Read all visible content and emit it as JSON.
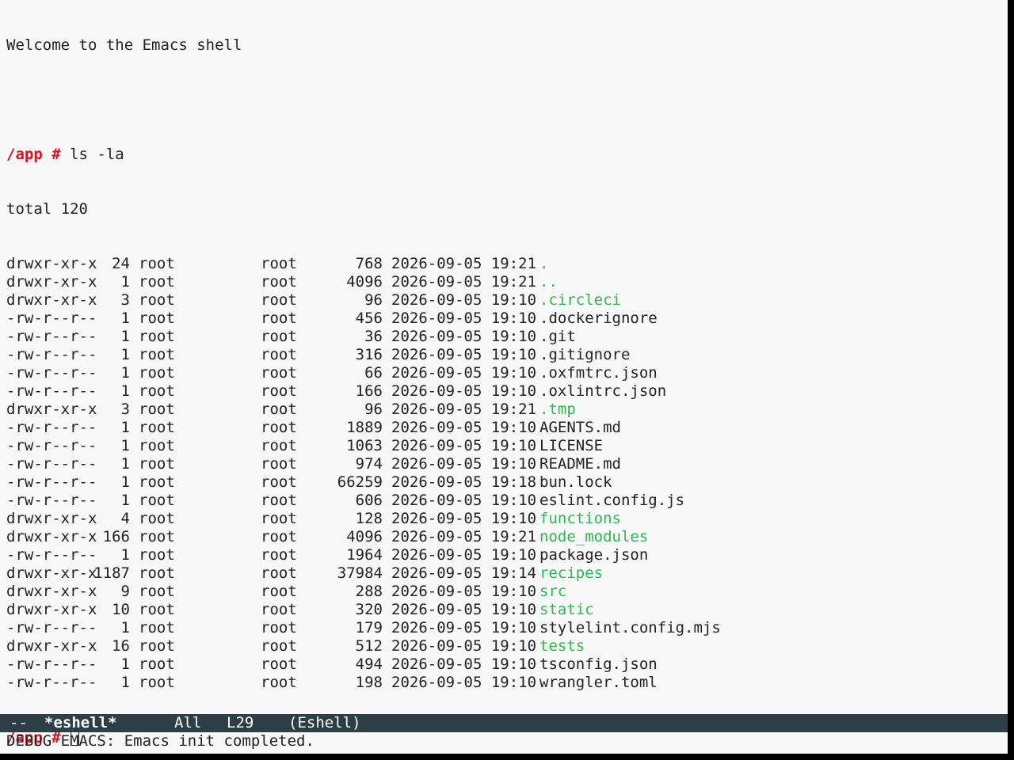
{
  "shell": {
    "welcome": "Welcome to the Emacs shell",
    "prompt": "/app #",
    "command": "ls -la",
    "total": "total 120",
    "prompt_trailing_space": " "
  },
  "listing": [
    {
      "perm": "drwxr-xr-x",
      "links": "24",
      "owner": "root",
      "group": "root",
      "size": "768",
      "date": "2026-09-05 19:21",
      "name": ".",
      "is_dir": true
    },
    {
      "perm": "drwxr-xr-x",
      "links": "1",
      "owner": "root",
      "group": "root",
      "size": "4096",
      "date": "2026-09-05 19:21",
      "name": "..",
      "is_dir": true
    },
    {
      "perm": "drwxr-xr-x",
      "links": "3",
      "owner": "root",
      "group": "root",
      "size": "96",
      "date": "2026-09-05 19:10",
      "name": ".circleci",
      "is_dir": true
    },
    {
      "perm": "-rw-r--r--",
      "links": "1",
      "owner": "root",
      "group": "root",
      "size": "456",
      "date": "2026-09-05 19:10",
      "name": ".dockerignore",
      "is_dir": false
    },
    {
      "perm": "-rw-r--r--",
      "links": "1",
      "owner": "root",
      "group": "root",
      "size": "36",
      "date": "2026-09-05 19:10",
      "name": ".git",
      "is_dir": false
    },
    {
      "perm": "-rw-r--r--",
      "links": "1",
      "owner": "root",
      "group": "root",
      "size": "316",
      "date": "2026-09-05 19:10",
      "name": ".gitignore",
      "is_dir": false
    },
    {
      "perm": "-rw-r--r--",
      "links": "1",
      "owner": "root",
      "group": "root",
      "size": "66",
      "date": "2026-09-05 19:10",
      "name": ".oxfmtrc.json",
      "is_dir": false
    },
    {
      "perm": "-rw-r--r--",
      "links": "1",
      "owner": "root",
      "group": "root",
      "size": "166",
      "date": "2026-09-05 19:10",
      "name": ".oxlintrc.json",
      "is_dir": false
    },
    {
      "perm": "drwxr-xr-x",
      "links": "3",
      "owner": "root",
      "group": "root",
      "size": "96",
      "date": "2026-09-05 19:21",
      "name": ".tmp",
      "is_dir": true
    },
    {
      "perm": "-rw-r--r--",
      "links": "1",
      "owner": "root",
      "group": "root",
      "size": "1889",
      "date": "2026-09-05 19:10",
      "name": "AGENTS.md",
      "is_dir": false
    },
    {
      "perm": "-rw-r--r--",
      "links": "1",
      "owner": "root",
      "group": "root",
      "size": "1063",
      "date": "2026-09-05 19:10",
      "name": "LICENSE",
      "is_dir": false
    },
    {
      "perm": "-rw-r--r--",
      "links": "1",
      "owner": "root",
      "group": "root",
      "size": "974",
      "date": "2026-09-05 19:10",
      "name": "README.md",
      "is_dir": false
    },
    {
      "perm": "-rw-r--r--",
      "links": "1",
      "owner": "root",
      "group": "root",
      "size": "66259",
      "date": "2026-09-05 19:18",
      "name": "bun.lock",
      "is_dir": false
    },
    {
      "perm": "-rw-r--r--",
      "links": "1",
      "owner": "root",
      "group": "root",
      "size": "606",
      "date": "2026-09-05 19:10",
      "name": "eslint.config.js",
      "is_dir": false
    },
    {
      "perm": "drwxr-xr-x",
      "links": "4",
      "owner": "root",
      "group": "root",
      "size": "128",
      "date": "2026-09-05 19:10",
      "name": "functions",
      "is_dir": true
    },
    {
      "perm": "drwxr-xr-x",
      "links": "166",
      "owner": "root",
      "group": "root",
      "size": "4096",
      "date": "2026-09-05 19:21",
      "name": "node_modules",
      "is_dir": true
    },
    {
      "perm": "-rw-r--r--",
      "links": "1",
      "owner": "root",
      "group": "root",
      "size": "1964",
      "date": "2026-09-05 19:10",
      "name": "package.json",
      "is_dir": false
    },
    {
      "perm": "drwxr-xr-x",
      "links": "1187",
      "owner": "root",
      "group": "root",
      "size": "37984",
      "date": "2026-09-05 19:14",
      "name": "recipes",
      "is_dir": true
    },
    {
      "perm": "drwxr-xr-x",
      "links": "9",
      "owner": "root",
      "group": "root",
      "size": "288",
      "date": "2026-09-05 19:10",
      "name": "src",
      "is_dir": true
    },
    {
      "perm": "drwxr-xr-x",
      "links": "10",
      "owner": "root",
      "group": "root",
      "size": "320",
      "date": "2026-09-05 19:10",
      "name": "static",
      "is_dir": true
    },
    {
      "perm": "-rw-r--r--",
      "links": "1",
      "owner": "root",
      "group": "root",
      "size": "179",
      "date": "2026-09-05 19:10",
      "name": "stylelint.config.mjs",
      "is_dir": false
    },
    {
      "perm": "drwxr-xr-x",
      "links": "16",
      "owner": "root",
      "group": "root",
      "size": "512",
      "date": "2026-09-05 19:10",
      "name": "tests",
      "is_dir": true
    },
    {
      "perm": "-rw-r--r--",
      "links": "1",
      "owner": "root",
      "group": "root",
      "size": "494",
      "date": "2026-09-05 19:10",
      "name": "tsconfig.json",
      "is_dir": false
    },
    {
      "perm": "-rw-r--r--",
      "links": "1",
      "owner": "root",
      "group": "root",
      "size": "198",
      "date": "2026-09-05 19:10",
      "name": "wrangler.toml",
      "is_dir": false
    }
  ],
  "modeline": {
    "status": "--",
    "buffer_name": "*eshell*",
    "position": "All",
    "line": "L29",
    "mode": "(Eshell)"
  },
  "echo_area": {
    "message": "DEBUG EMACS: Emacs init completed."
  },
  "colors": {
    "background": "#f8f8f8",
    "text": "#222222",
    "prompt": "#e0141e",
    "directory": "#2db84d",
    "modeline_bg": "#2c3e46",
    "modeline_fg": "#ffffff"
  }
}
